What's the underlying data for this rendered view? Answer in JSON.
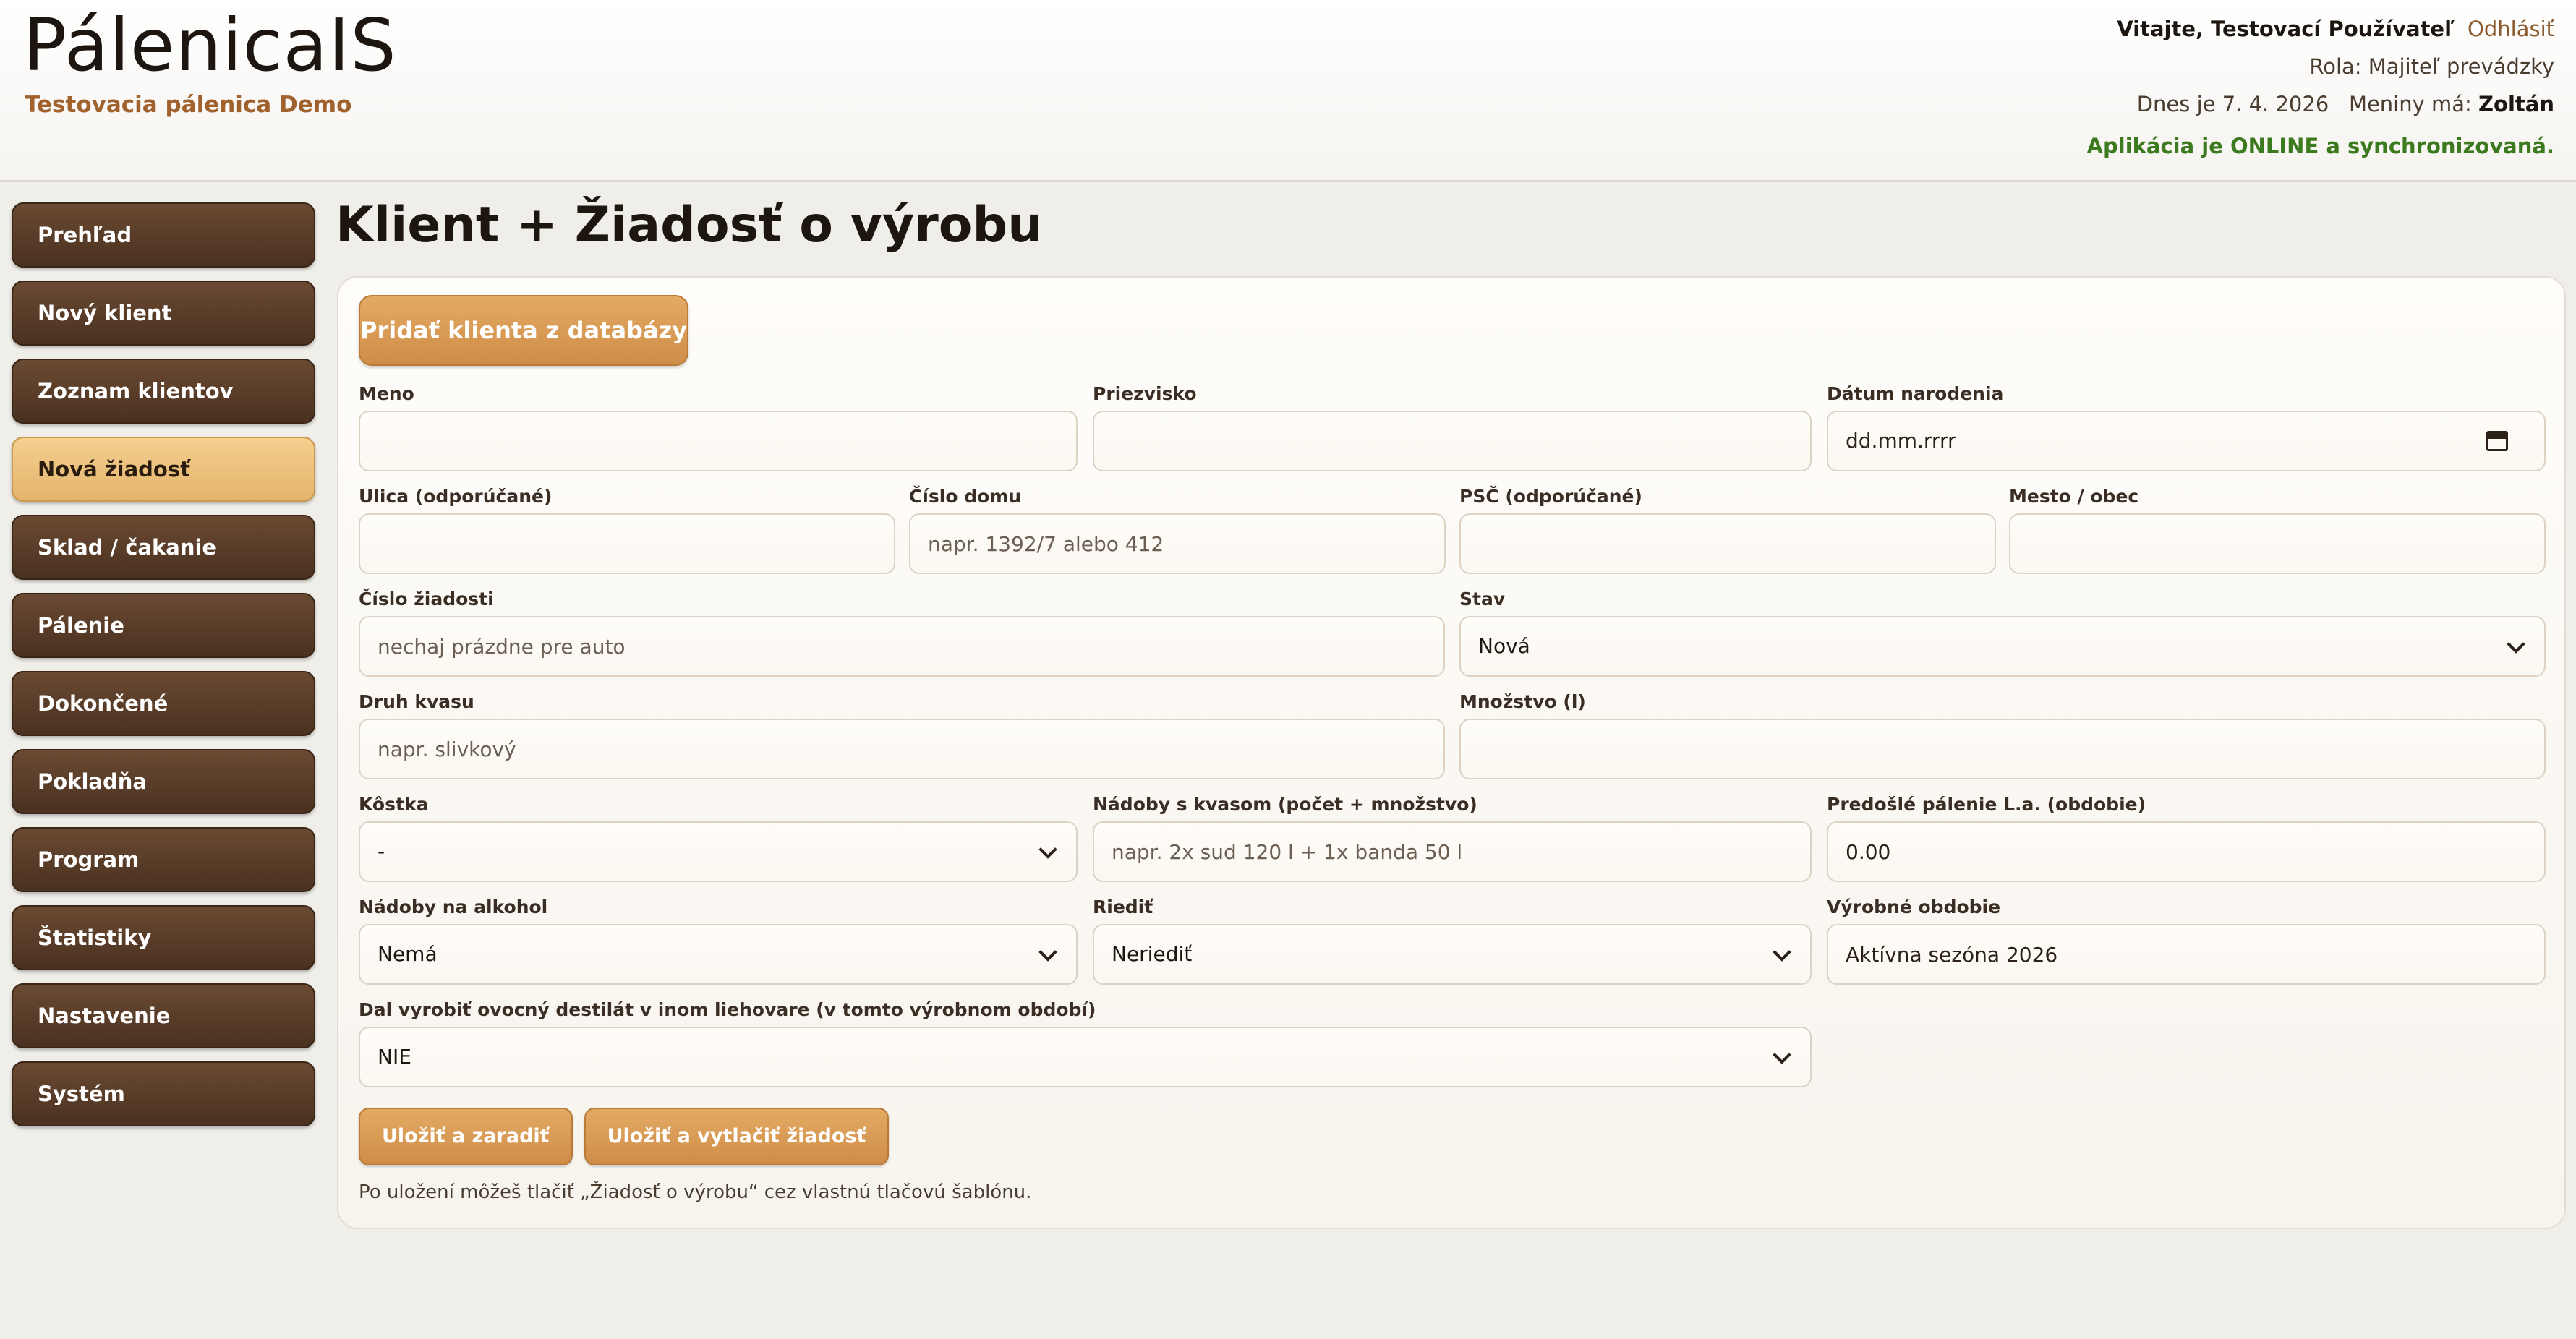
{
  "header": {
    "logo": "PálenicaIS",
    "organization": "Testovacia pálenica Demo",
    "welcome": "Vitajte, Testovací Používateľ",
    "logout": "Odhlásiť",
    "role": "Rola: Majiteľ prevádzky",
    "today": "Dnes je 7. 4. 2026",
    "nameday_label": "Meniny má:",
    "nameday_name": "Zoltán",
    "status": "Aplikácia je ONLINE a synchronizovaná."
  },
  "sidebar": {
    "items": [
      {
        "label": "Prehľad"
      },
      {
        "label": "Nový klient"
      },
      {
        "label": "Zoznam klientov"
      },
      {
        "label": "Nová žiadosť",
        "active": true
      },
      {
        "label": "Sklad / čakanie"
      },
      {
        "label": "Pálenie"
      },
      {
        "label": "Dokončené"
      },
      {
        "label": "Pokladňa"
      },
      {
        "label": "Program"
      },
      {
        "label": "Štatistiky"
      },
      {
        "label": "Nastavenie"
      },
      {
        "label": "Systém"
      }
    ]
  },
  "page": {
    "title": "Klient + Žiadosť o výrobu",
    "add_client_button": "Pridať klienta z databázy"
  },
  "form": {
    "meno": {
      "label": "Meno",
      "value": "",
      "placeholder": ""
    },
    "priezvisko": {
      "label": "Priezvisko",
      "value": "",
      "placeholder": ""
    },
    "datum_narodenia": {
      "label": "Dátum narodenia",
      "value": "dd.mm.rrrr"
    },
    "ulica": {
      "label": "Ulica (odporúčané)",
      "value": "",
      "placeholder": ""
    },
    "cislo_domu": {
      "label": "Číslo domu",
      "value": "",
      "placeholder": "napr. 1392/7 alebo 412"
    },
    "psc": {
      "label": "PSČ (odporúčané)",
      "value": "",
      "placeholder": ""
    },
    "mesto": {
      "label": "Mesto / obec",
      "value": "",
      "placeholder": ""
    },
    "cislo_ziadosti": {
      "label": "Číslo žiadosti",
      "value": "",
      "placeholder": "nechaj prázdne pre auto"
    },
    "stav": {
      "label": "Stav",
      "value": "Nová"
    },
    "druh_kvasu": {
      "label": "Druh kvasu",
      "value": "",
      "placeholder": "napr. slivkový"
    },
    "mnozstvo": {
      "label": "Množstvo (l)",
      "value": "",
      "placeholder": ""
    },
    "kostka": {
      "label": "Kôstka",
      "value": "-"
    },
    "nadoby_kvas": {
      "label": "Nádoby s kvasom (počet + množstvo)",
      "value": "",
      "placeholder": "napr. 2x sud 120 l + 1x banda 50 l"
    },
    "predosle_palenie": {
      "label": "Predošlé pálenie L.a. (obdobie)",
      "value": "0.00"
    },
    "nadoby_alkohol": {
      "label": "Nádoby na alkohol",
      "value": "Nemá"
    },
    "riedit": {
      "label": "Riediť",
      "value": "Neriediť"
    },
    "vyrobne_obdobie": {
      "label": "Výrobné obdobie",
      "value": "Aktívna sezóna 2026"
    },
    "iny_lieh": {
      "label": "Dal vyrobiť ovocný destilát v inom liehovare (v tomto výrobnom období)",
      "value": "NIE"
    }
  },
  "actions": {
    "save_queue": "Uložiť a zaradiť",
    "save_print": "Uložiť a vytlačiť žiadosť",
    "hint": "Po uložení môžeš tlačiť „Žiadosť o výrobu“ cez vlastnú tlačovú šablónu."
  }
}
